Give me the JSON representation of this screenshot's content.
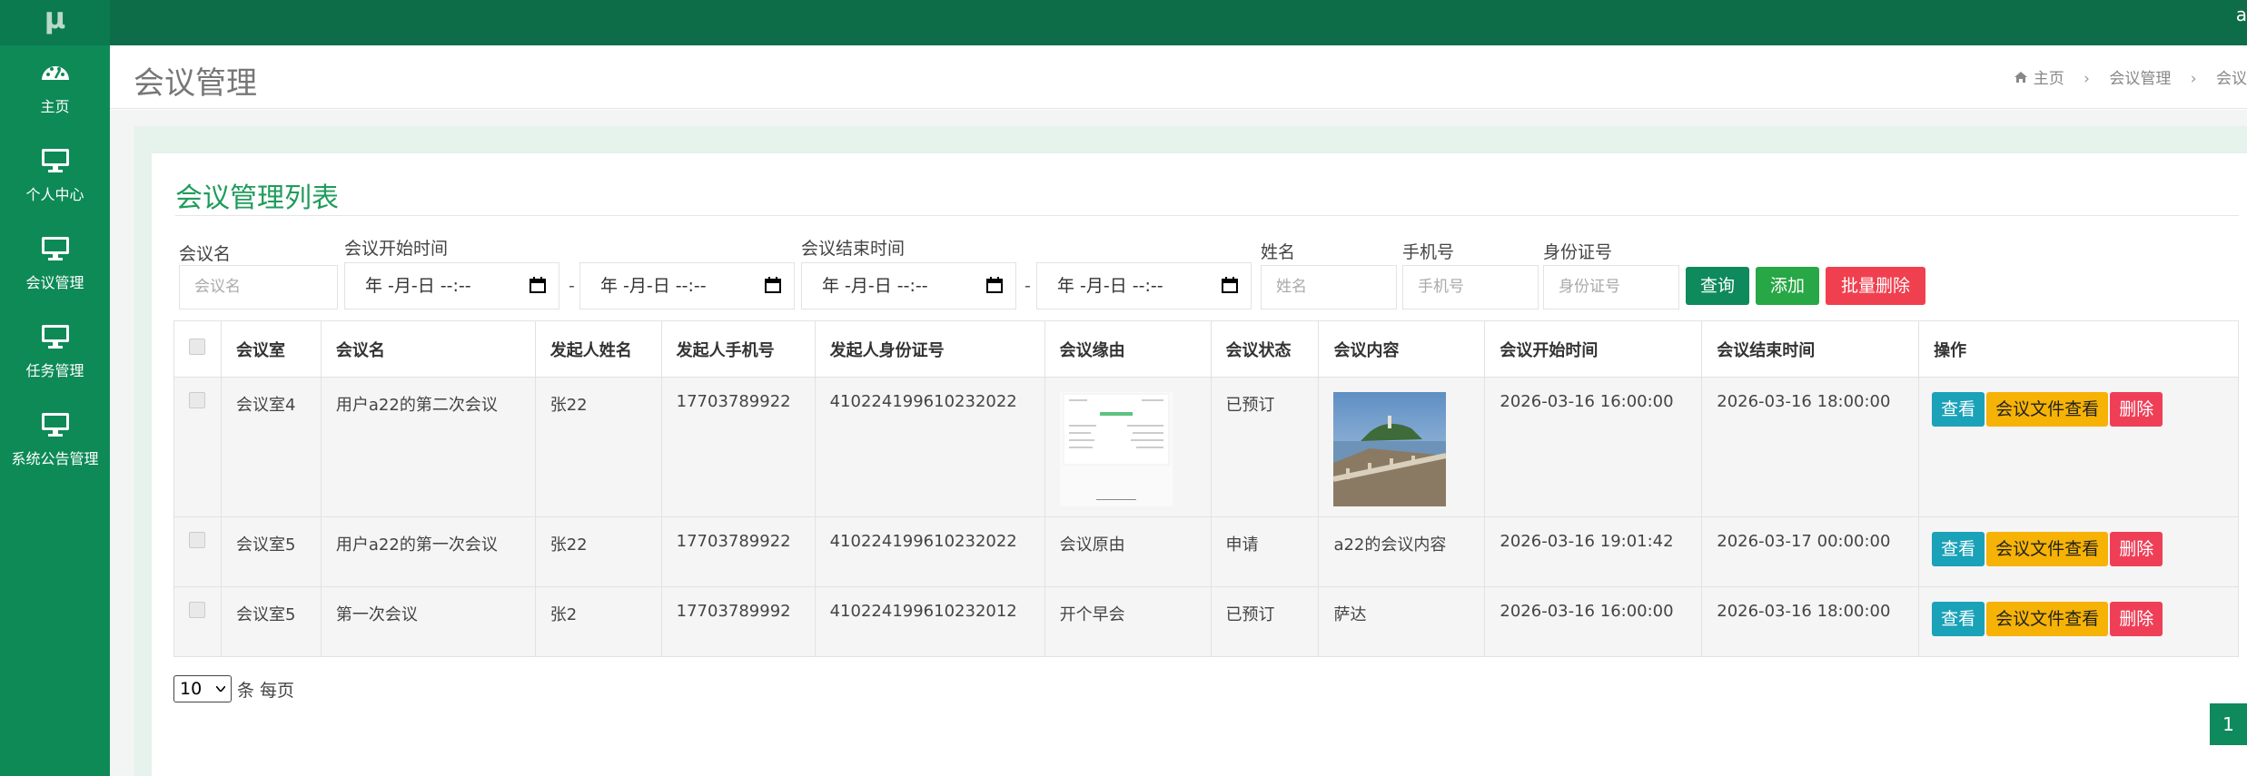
{
  "topbar": {
    "logo": "μ",
    "user": "a"
  },
  "sidebar": {
    "items": [
      {
        "label": "主页",
        "icon": "dashboard-icon"
      },
      {
        "label": "个人中心",
        "icon": "monitor-icon"
      },
      {
        "label": "会议管理",
        "icon": "monitor-icon"
      },
      {
        "label": "任务管理",
        "icon": "monitor-icon"
      },
      {
        "label": "系统公告管理",
        "icon": "monitor-icon"
      }
    ]
  },
  "header": {
    "title": "会议管理",
    "breadcrumb": {
      "home": "主页",
      "level1": "会议管理",
      "level2": "会议"
    }
  },
  "card": {
    "title": "会议管理列表"
  },
  "filters": {
    "meeting_name": {
      "label": "会议名",
      "placeholder": "会议名"
    },
    "start_time": {
      "label": "会议开始时间",
      "from": "年 -月-日  --:--",
      "to": "年 -月-日  --:--"
    },
    "end_time": {
      "label": "会议结束时间",
      "from": "年 -月-日  --:--",
      "to": "年 -月-日  --:--"
    },
    "range_sep": "-",
    "name": {
      "label": "姓名",
      "placeholder": "姓名"
    },
    "phone": {
      "label": "手机号",
      "placeholder": "手机号"
    },
    "id_card": {
      "label": "身份证号",
      "placeholder": "身份证号"
    },
    "buttons": {
      "query": "查询",
      "add": "添加",
      "batch_delete": "批量删除"
    }
  },
  "table": {
    "headers": [
      "会议室",
      "会议名",
      "发起人姓名",
      "发起人手机号",
      "发起人身份证号",
      "会议缘由",
      "会议状态",
      "会议内容",
      "会议开始时间",
      "会议结束时间",
      "操作"
    ],
    "rows": [
      {
        "room": "会议室4",
        "name": "用户a22的第二次会议",
        "initiator": "张22",
        "phone": "17703789922",
        "id_card": "410224199610232022",
        "reason": "",
        "status": "已预订",
        "content": "",
        "start": "2026-03-16 16:00:00",
        "end": "2026-03-16 18:00:00"
      },
      {
        "room": "会议室5",
        "name": "用户a22的第一次会议",
        "initiator": "张22",
        "phone": "17703789922",
        "id_card": "410224199610232022",
        "reason": "会议原由",
        "status": "申请",
        "content": "a22的会议内容",
        "start": "2026-03-16 19:01:42",
        "end": "2026-03-17 00:00:00"
      },
      {
        "room": "会议室5",
        "name": "第一次会议",
        "initiator": "张2",
        "phone": "17703789992",
        "id_card": "410224199610232012",
        "reason": "开个早会",
        "status": "已预订",
        "content": "萨达",
        "start": "2026-03-16 16:00:00",
        "end": "2026-03-16 18:00:00"
      }
    ],
    "actions": {
      "view": "查看",
      "files": "会议文件查看",
      "delete": "删除"
    }
  },
  "pager": {
    "page_size": "10",
    "page_size_suffix": "条 每页",
    "current_page": "1"
  },
  "colors": {
    "topbar": "#0e6d49",
    "sidebar": "#0e8a57",
    "accent": "#1f9c5c",
    "danger": "#f0404f",
    "warning": "#f6b305",
    "info": "#1aa2b8"
  }
}
